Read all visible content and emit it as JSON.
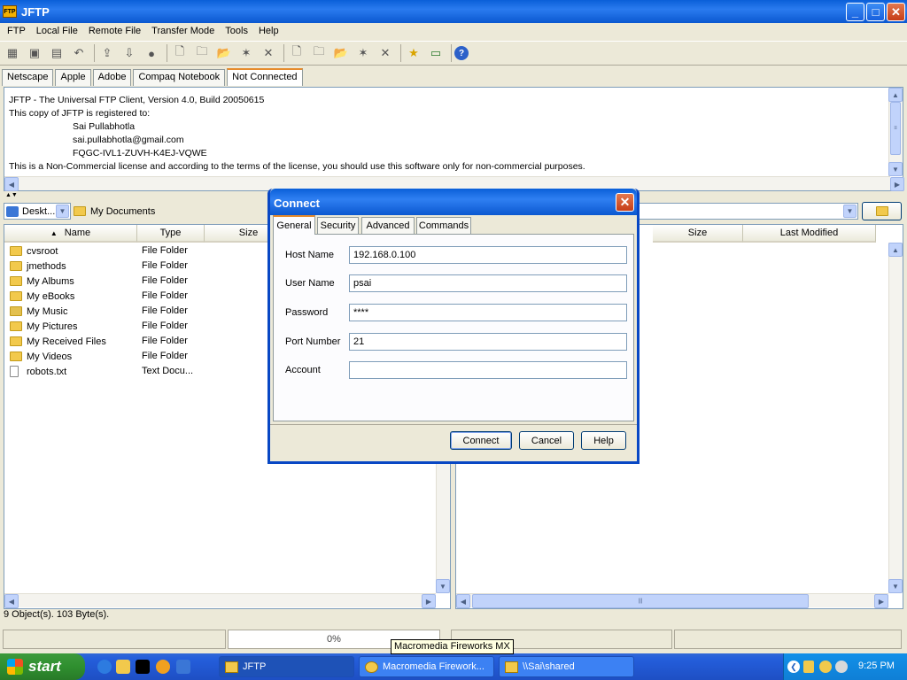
{
  "window": {
    "title": "JFTP",
    "app_icon": "FTP"
  },
  "menu": [
    "FTP",
    "Local File",
    "Remote File",
    "Transfer Mode",
    "Tools",
    "Help"
  ],
  "site_tabs": [
    "Netscape",
    "Apple",
    "Adobe",
    "Compaq Notebook",
    "Not Connected"
  ],
  "active_site_tab": "Not Connected",
  "log": {
    "line1": "JFTP - The Universal FTP Client, Version 4.0, Build 20050615",
    "line2": "This copy of JFTP is registered to:",
    "line3": "Sai Pullabhotla",
    "line4": "sai.pullabhotla@gmail.com",
    "line5": "FQGC-IVL1-ZUVH-K4EJ-VQWE",
    "line6": "This is a Non-Commercial license and according to the terms of the license, you should use this software only for non-commercial purposes."
  },
  "local": {
    "drive": "Deskt...",
    "folder": "My Documents",
    "columns": {
      "name": "Name",
      "type": "Type",
      "size": "Size"
    },
    "files": [
      {
        "name": "cvsroot",
        "type": "File Folder",
        "icon": "folder-icon"
      },
      {
        "name": "jmethods",
        "type": "File Folder",
        "icon": "folder-icon"
      },
      {
        "name": "My Albums",
        "type": "File Folder",
        "icon": "folder-icon"
      },
      {
        "name": "My eBooks",
        "type": "File Folder",
        "icon": "folder-icon"
      },
      {
        "name": "My Music",
        "type": "File Folder",
        "icon": "music-folder-icon"
      },
      {
        "name": "My Pictures",
        "type": "File Folder",
        "icon": "pictures-folder-icon"
      },
      {
        "name": "My Received Files",
        "type": "File Folder",
        "icon": "folder-icon"
      },
      {
        "name": "My Videos",
        "type": "File Folder",
        "icon": "folder-icon"
      },
      {
        "name": "robots.txt",
        "type": "Text Docu...",
        "icon": "text-file-icon"
      }
    ],
    "status": "9 Object(s). 103 Byte(s)."
  },
  "remote": {
    "columns": {
      "size": "Size",
      "modified": "Last Modified"
    }
  },
  "progress": {
    "text": "0%",
    "value": 0
  },
  "dialog": {
    "title": "Connect",
    "tabs": [
      "General",
      "Security",
      "Advanced",
      "Commands"
    ],
    "active_tab": "General",
    "fields": {
      "host_label": "Host Name",
      "host_value": "192.168.0.100",
      "user_label": "User Name",
      "user_value": "psai",
      "password_label": "Password",
      "password_value": "****",
      "port_label": "Port Number",
      "port_value": "21",
      "account_label": "Account",
      "account_value": ""
    },
    "buttons": {
      "connect": "Connect",
      "cancel": "Cancel",
      "help": "Help"
    }
  },
  "tooltip": "Macromedia Fireworks MX",
  "taskbar": {
    "start": "start",
    "tasks": [
      "JFTP",
      "Macromedia Firework...",
      "\\\\Sai\\shared"
    ],
    "clock": "9:25 PM"
  },
  "colors": {
    "xp_blue": "#0a5fd8",
    "close_red": "#c63d17",
    "tab_accent": "#e68b2c",
    "taskbar_blue": "#245edb",
    "start_green": "#2f8f2f"
  }
}
